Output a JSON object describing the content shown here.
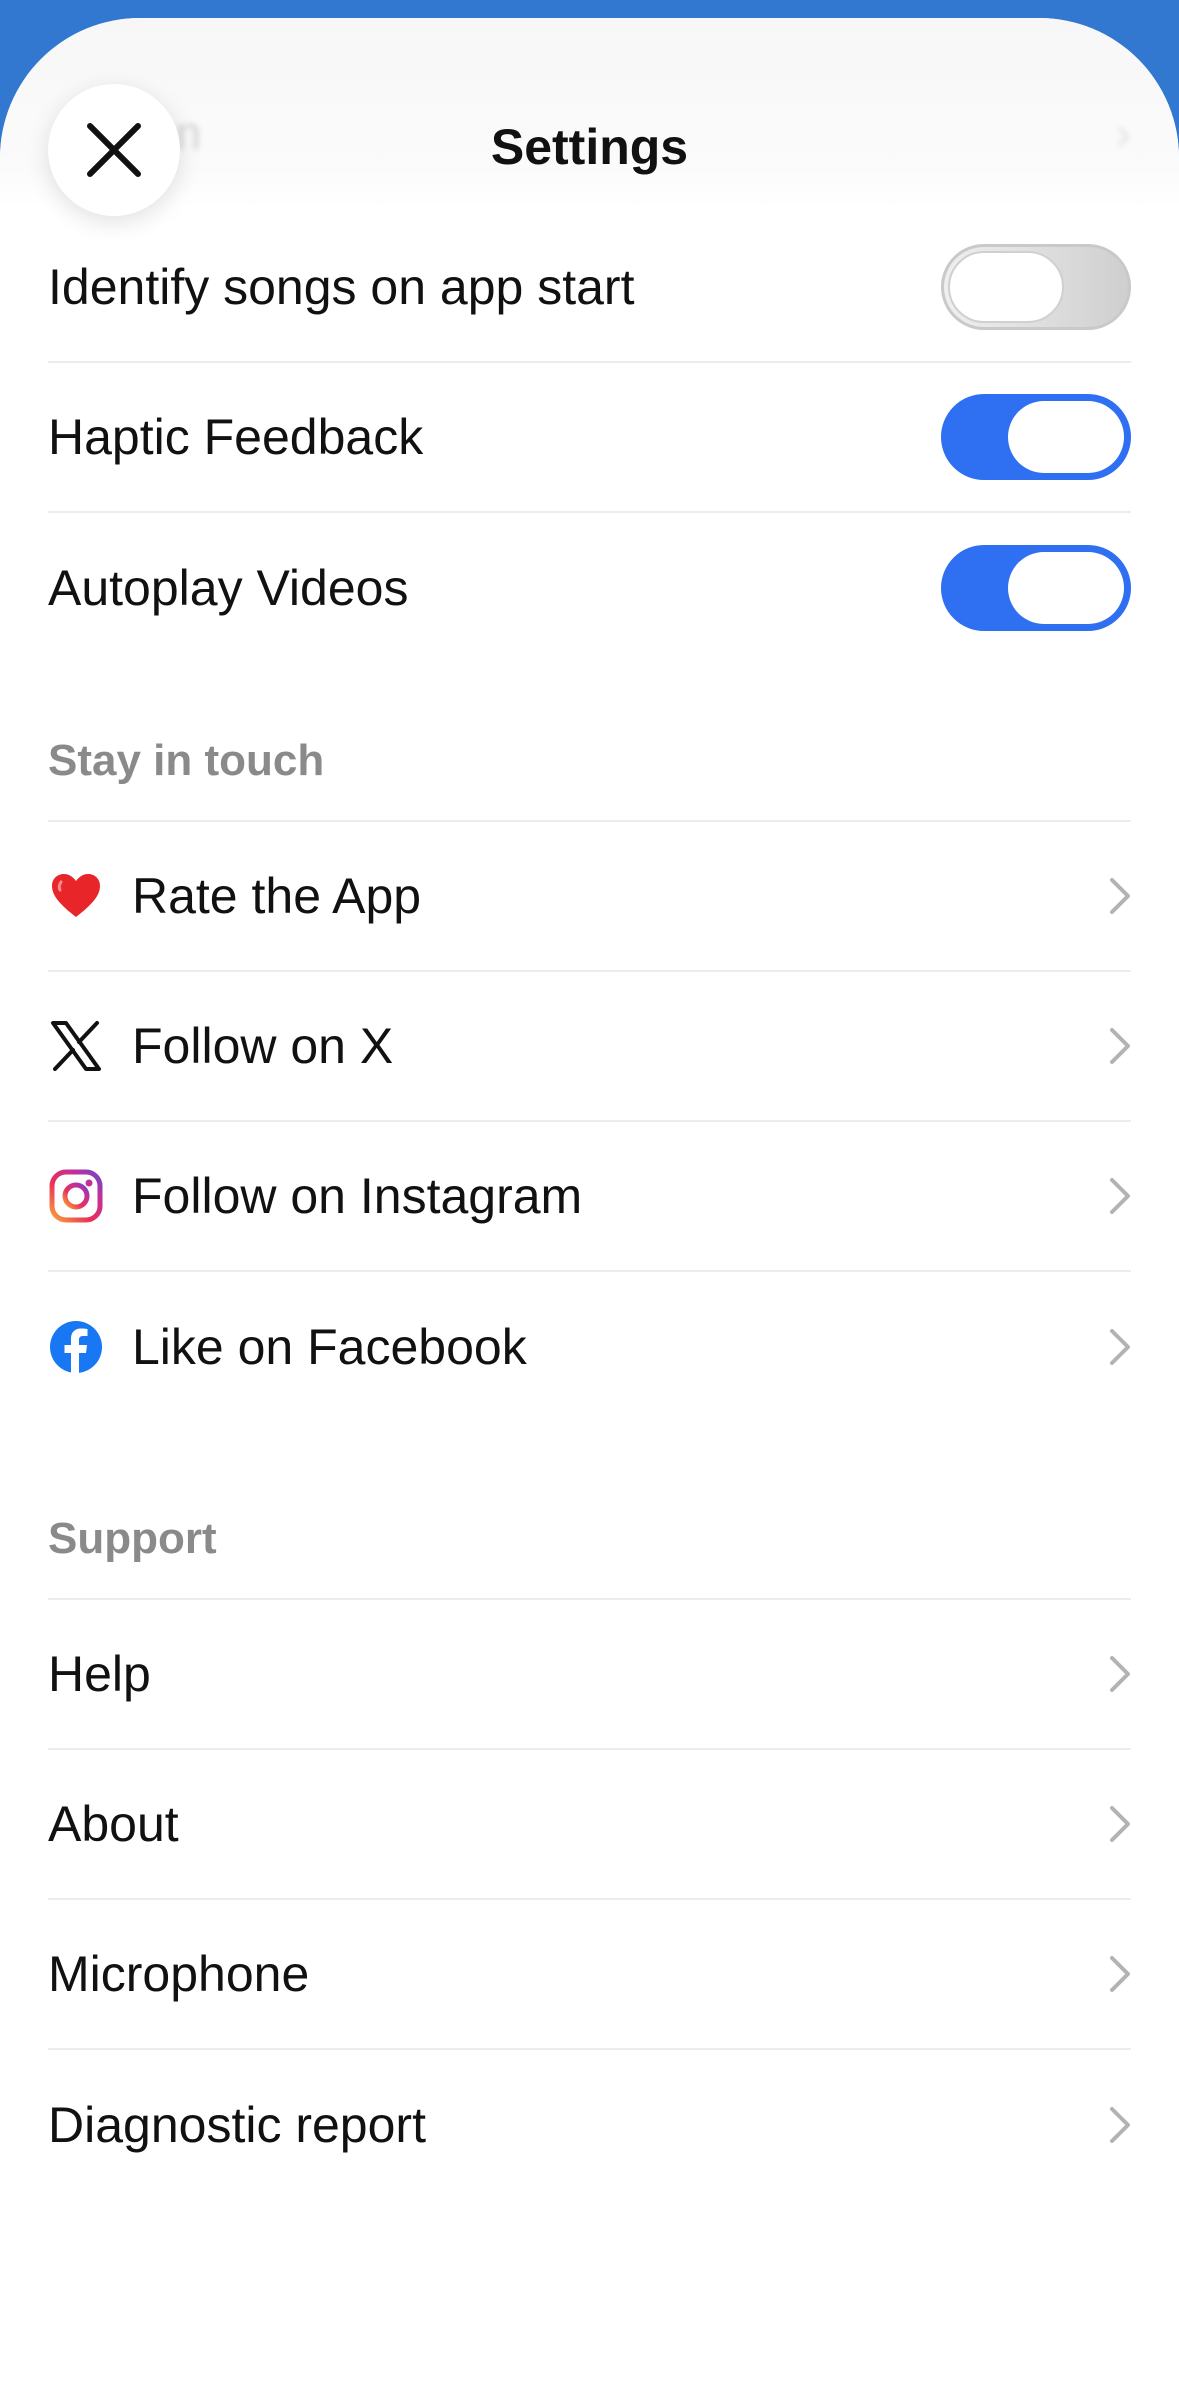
{
  "header": {
    "title": "Settings",
    "peek_text": "on"
  },
  "toggles": [
    {
      "label": "Identify songs on app start",
      "state": "off"
    },
    {
      "label": "Haptic Feedback",
      "state": "on"
    },
    {
      "label": "Autoplay Videos",
      "state": "on"
    }
  ],
  "stay_in_touch": {
    "title": "Stay in touch",
    "items": [
      {
        "label": "Rate the App",
        "icon": "heart-icon"
      },
      {
        "label": "Follow on X",
        "icon": "x-logo-icon"
      },
      {
        "label": "Follow on Instagram",
        "icon": "instagram-icon"
      },
      {
        "label": "Like on Facebook",
        "icon": "facebook-icon"
      }
    ]
  },
  "support": {
    "title": "Support",
    "items": [
      {
        "label": "Help"
      },
      {
        "label": "About"
      },
      {
        "label": "Microphone"
      },
      {
        "label": "Diagnostic report"
      }
    ]
  },
  "colors": {
    "accent": "#2f6ff2",
    "backdrop": "#3277d0",
    "section_title": "#8a8a8a"
  }
}
